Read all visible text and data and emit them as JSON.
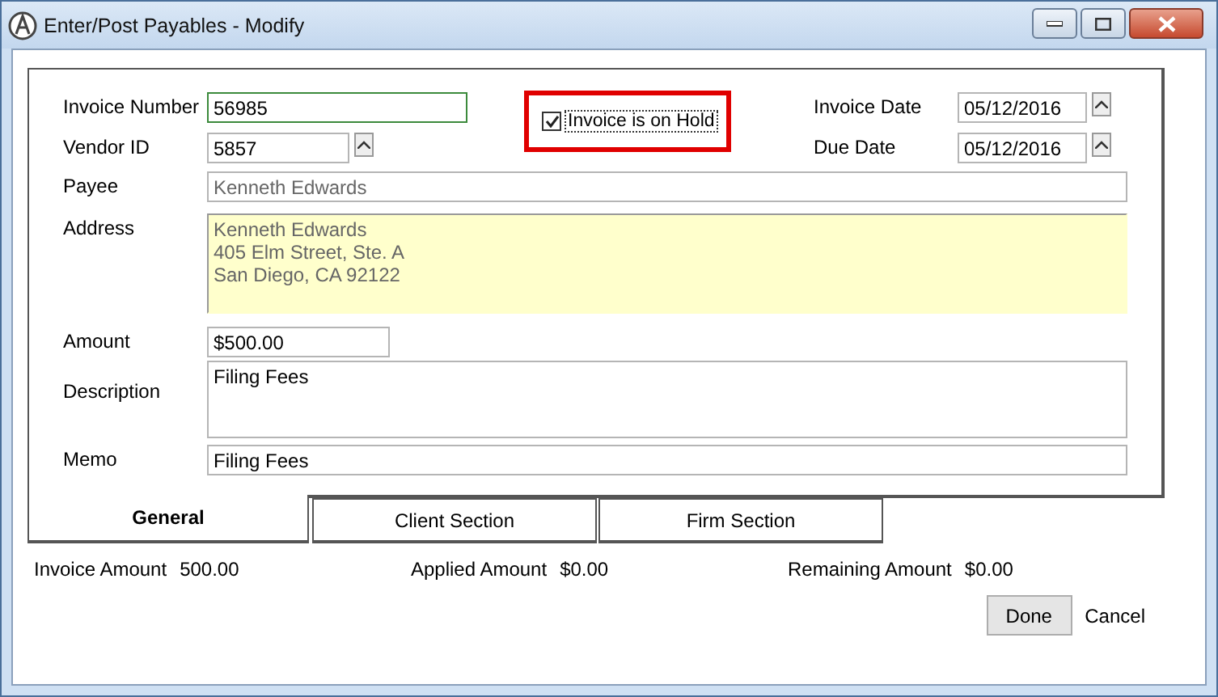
{
  "window": {
    "title": "Enter/Post Payables - Modify"
  },
  "form": {
    "invoice_number": {
      "label": "Invoice Number",
      "value": "56985",
      "focused": true
    },
    "vendor_id": {
      "label": "Vendor ID",
      "value": "5857"
    },
    "hold": {
      "label": "Invoice is on Hold",
      "checked": true,
      "highlighted": true
    },
    "invoice_date": {
      "label": "Invoice Date",
      "value": "05/12/2016"
    },
    "due_date": {
      "label": "Due Date",
      "value": "05/12/2016"
    },
    "payee": {
      "label": "Payee",
      "value": "Kenneth Edwards"
    },
    "address": {
      "label": "Address",
      "lines": [
        "Kenneth Edwards",
        "405 Elm Street, Ste. A",
        "San Diego, CA 92122"
      ]
    },
    "amount": {
      "label": "Amount",
      "value": "$500.00"
    },
    "description": {
      "label": "Description",
      "value": "Filing Fees"
    },
    "memo": {
      "label": "Memo",
      "value": "Filing Fees"
    }
  },
  "tabs": [
    {
      "label": "General",
      "selected": true
    },
    {
      "label": "Client Section",
      "selected": false
    },
    {
      "label": "Firm Section",
      "selected": false
    }
  ],
  "totals": [
    {
      "label": "Invoice Amount",
      "value": "500.00"
    },
    {
      "label": "Applied Amount",
      "value": "$0.00"
    },
    {
      "label": "Remaining Amount",
      "value": "$0.00"
    }
  ],
  "buttons": [
    {
      "label": "Done",
      "kind": "button"
    },
    {
      "label": "Cancel",
      "kind": "link"
    }
  ]
}
